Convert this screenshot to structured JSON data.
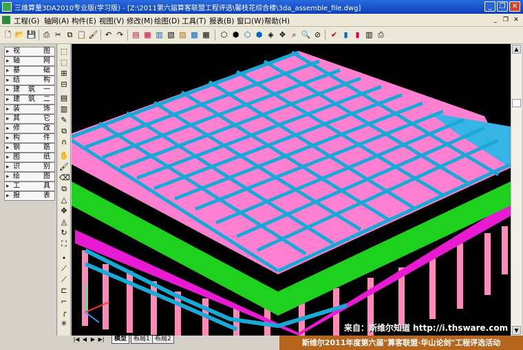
{
  "window": {
    "title": "三维算量3DA2010专业版(学习版) - [Z:\\2011第六届算客联盟工程评选\\馨枝花综合楼\\3da_assemble_file.dwg]",
    "buttons": {
      "minimize": "_",
      "restore": "❐",
      "close": "✕"
    }
  },
  "menu": {
    "items": [
      "工程(G)",
      "轴网(A)",
      "构件(E)",
      "视图(V)",
      "修改(M)",
      "绘图(D)",
      "工具(T)",
      "报表(B)",
      "窗口(W)",
      "帮助(H)"
    ],
    "mdi_buttons": [
      "_",
      "❐",
      "✕"
    ]
  },
  "sidebar": {
    "items": [
      "视图",
      "轴网",
      "基础",
      "结构",
      "建筑一",
      "建筑二",
      "装饰",
      "其它",
      "修改",
      "构件",
      "钢筋",
      "图纸",
      "识别",
      "绘图",
      "工具",
      "报表"
    ]
  },
  "tabs": {
    "nav": [
      "|◀",
      "◀",
      "▶",
      "▶|"
    ],
    "items": [
      "模型",
      "布局1",
      "布局2"
    ]
  },
  "overlay": {
    "source": "来自：斯维尔知道 http://i.thsware.com",
    "banner": "斯维尔2011年度第六届\"算客联盟·华山论剑\"工程评选活动"
  },
  "colors": {
    "title_bar": "#0a3fb8",
    "viewport_bg": "#000000",
    "beam": "#19a9d6",
    "slab": "#ff7fd0",
    "wall": "#1fd11f",
    "banner": "#b5651d"
  }
}
